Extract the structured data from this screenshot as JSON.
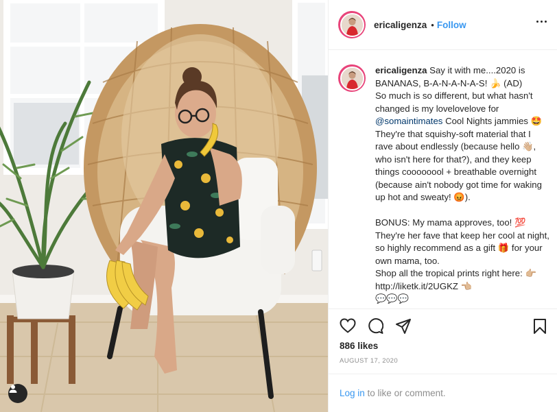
{
  "post": {
    "username": "ericaligenza",
    "follow_separator": "•",
    "follow_label": "Follow",
    "caption_username": "ericaligenza",
    "caption_part1": " Say it with me....2020 is BANANAS, B-A-N-A-N-A-S! 🍌 (AD)\nSo much is so different, but what hasn't changed is my lovelovelove for ",
    "caption_mention": "@somaintimates",
    "caption_part2": " Cool Nights jammies 🤩 They're that squishy-soft material that I rave about endlessly (because hello 👋🏼, who isn't here for that?), and they keep things coooooool + breathable overnight (because ain't nobody got time for waking up hot and sweaty! 😡).\n\nBONUS: My mama approves, too! 💯 They're her fave that keep her cool at night, so highly recommend as a gift 🎁 for your own mama, too.\nShop all the tropical prints right here: 👉🏼 http://liketk.it/2UGKZ 👈🏼\n💬💬💬",
    "likes": "886 likes",
    "date": "AUGUST 17, 2020",
    "login_link": "Log in",
    "login_rest": " to like or comment."
  },
  "icons": {
    "more": "more-options-icon",
    "like": "heart-icon",
    "comment": "comment-icon",
    "share": "share-icon",
    "save": "bookmark-icon",
    "user_tag": "user-tag-icon"
  },
  "colors": {
    "accent": "#3897f0",
    "text": "#262626",
    "muted": "#8e8e8e",
    "mention": "#00376b",
    "avatar_ring": "#e8447a"
  }
}
